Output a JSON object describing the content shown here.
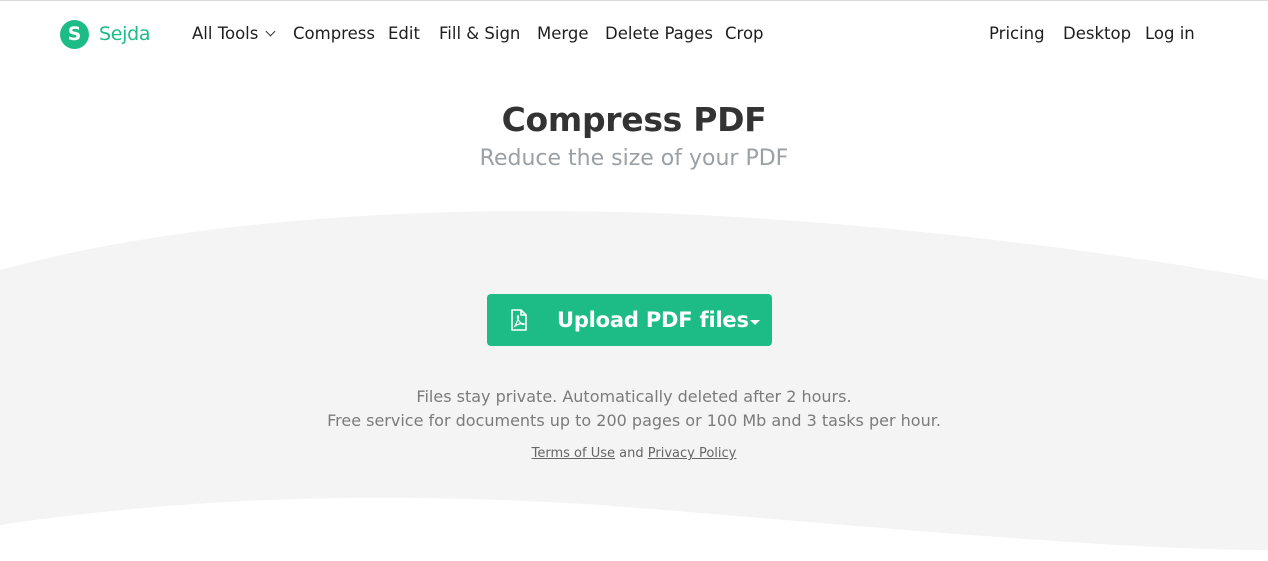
{
  "brand": {
    "name": "Sejda",
    "logo_letter": "S",
    "color": "#1dbc86"
  },
  "nav": {
    "left": [
      "All Tools",
      "Compress",
      "Edit",
      "Fill & Sign",
      "Merge",
      "Delete Pages",
      "Crop"
    ],
    "right": [
      "Pricing",
      "Desktop",
      "Log in"
    ]
  },
  "hero": {
    "title": "Compress PDF",
    "subtitle": "Reduce the size of your PDF"
  },
  "upload": {
    "label": "Upload PDF files",
    "icon": "pdf-file-icon",
    "dropdown_icon": "caret-down-icon"
  },
  "info": {
    "line1": "Files stay private. Automatically deleted after 2 hours.",
    "line2": "Free service for documents up to 200 pages or 100 Mb and 3 tasks per hour."
  },
  "legal": {
    "terms": "Terms of Use",
    "and": "and",
    "privacy": "Privacy Policy"
  },
  "colors": {
    "accent": "#1dbc86",
    "band": "#f4f4f4",
    "subtitle": "#9aa0a4"
  }
}
